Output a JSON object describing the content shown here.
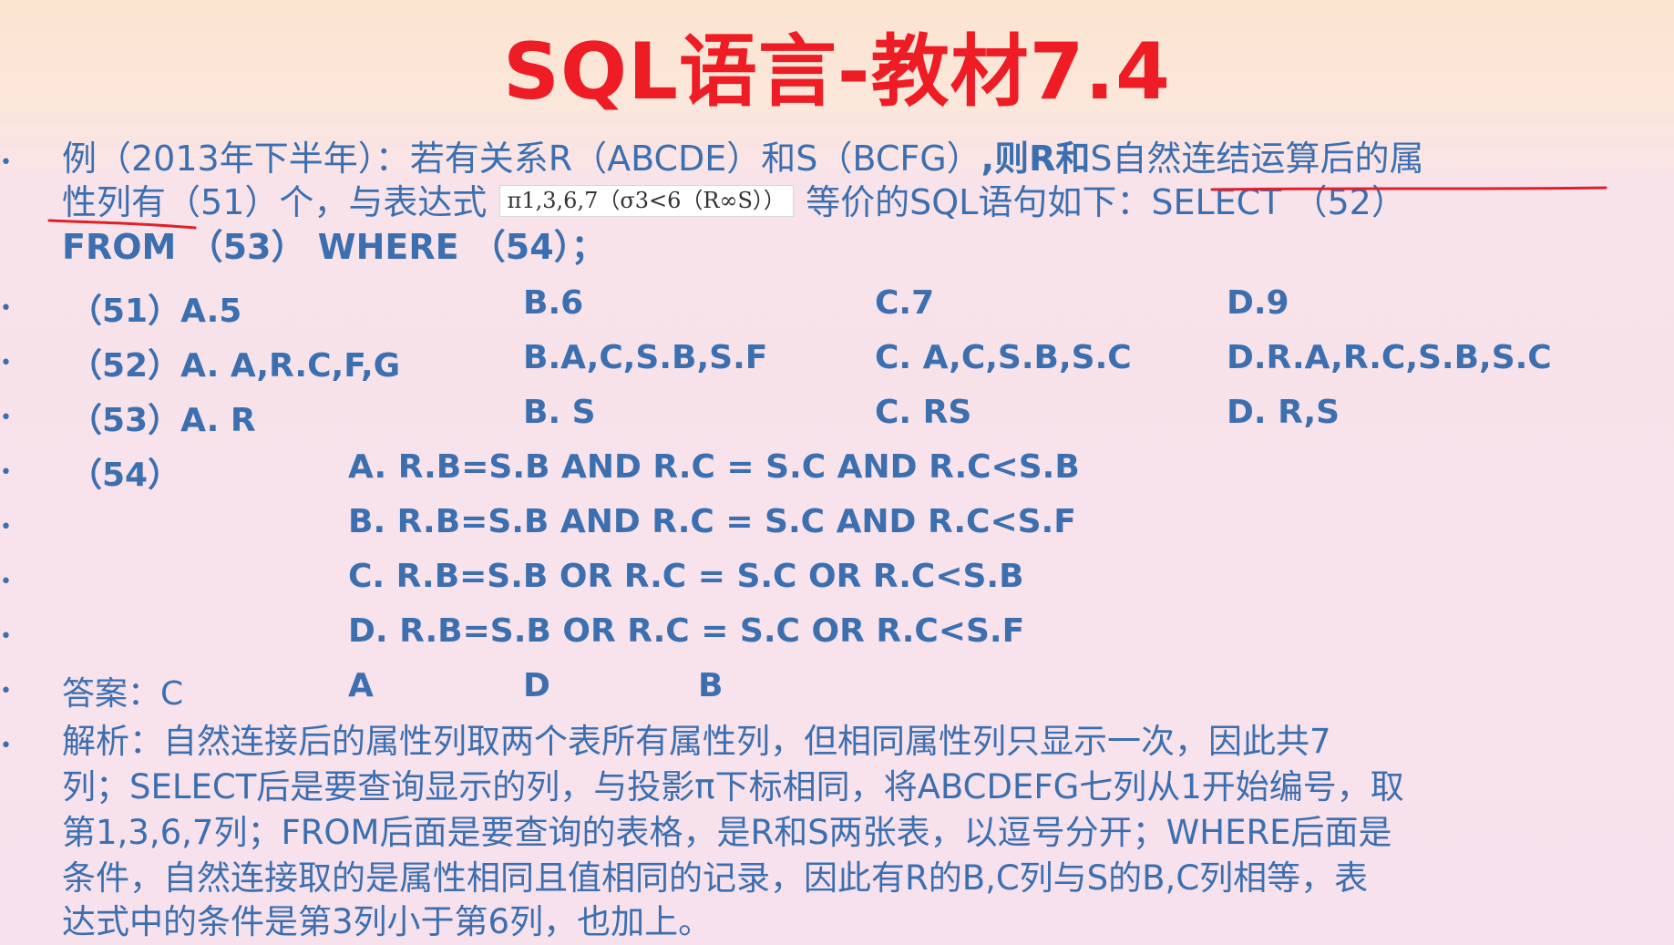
{
  "slide": {
    "title": "SQL语言-教材7.4"
  },
  "question": {
    "line1_prefix": "例（2013年下半年）：若有关系R（ABCDE）和S（BCFG）",
    "line1_mid": ",则R和",
    "line1_underlined": "S自然连结运算后的属",
    "line2_underlined": "性列有",
    "line2_mid": "（51）个，与表达式",
    "formula": "π1,3,6,7（σ3<6（R∞S））",
    "line2_suffix": "等价的SQL语句如下：SELECT （52）",
    "line3": "FROM （53） WHERE （54）；"
  },
  "options": {
    "q51": {
      "label": "（51）A.5",
      "b": "B.6",
      "c": "C.7",
      "d": "D.9"
    },
    "q52": {
      "label": "（52）A. A,R.C,F,G",
      "b": "B.A,C,S.B,S.F",
      "c": "C. A,C,S.B,S.C",
      "d": "D.R.A,R.C,S.B,S.C"
    },
    "q53": {
      "label": "（53）A. R",
      "b": "B. S",
      "c": "C. RS",
      "d": "D. R,S"
    },
    "q54": {
      "label": "（54）",
      "a": "A. R.B=S.B AND R.C = S.C AND R.C<S.B",
      "b": "B. R.B=S.B AND R.C = S.C AND R.C<S.F",
      "c": "C. R.B=S.B OR R.C = S.C OR R.C<S.B",
      "d": "D. R.B=S.B OR R.C = S.C OR R.C<S.F"
    }
  },
  "answer": {
    "label": "答案：C",
    "a2": "A",
    "a3": "D",
    "a4": "B"
  },
  "analysis": {
    "line1": "解析：自然连接后的属性列取两个表所有属性列，但相同属性列只显示一次，因此共7",
    "line2": "列；SELECT后是要查询显示的列，与投影π下标相同，将ABCDEFG七列从1开始编号，取",
    "line3": "第1,3,6,7列；FROM后面是要查询的表格，是R和S两张表，以逗号分开；WHERE后面是",
    "line4": "条件，自然连接取的是属性相同且值相同的记录，因此有R的B,C列与S的B,C列相等，表",
    "line5": "达式中的条件是第3列小于第6列，也加上。"
  },
  "colors": {
    "title": "#ee1c25",
    "text": "#3c6fb0",
    "annotation": "#e0202a"
  }
}
